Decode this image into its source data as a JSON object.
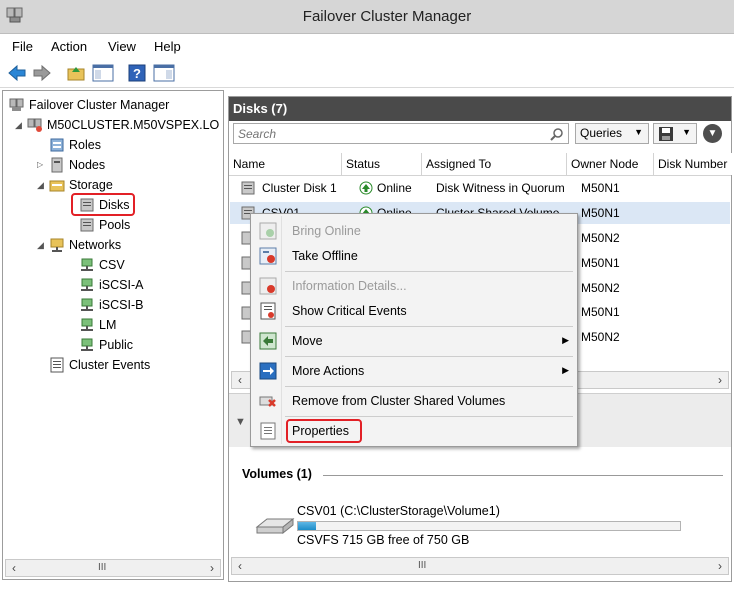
{
  "window": {
    "title": "Failover Cluster Manager"
  },
  "menu": [
    "File",
    "Action",
    "View",
    "Help"
  ],
  "tree": {
    "root": "Failover Cluster Manager",
    "cluster": "M50CLUSTER.M50VSPEX.LO",
    "roles": "Roles",
    "nodes": "Nodes",
    "storage": "Storage",
    "disks": "Disks",
    "pools": "Pools",
    "networks": "Networks",
    "net_csv": "CSV",
    "net_iscsi_a": "iSCSI-A",
    "net_iscsi_b": "iSCSI-B",
    "net_lm": "LM",
    "net_public": "Public",
    "cluster_events": "Cluster Events"
  },
  "scroll": {
    "thumb": "III"
  },
  "disks": {
    "header": "Disks (7)",
    "search_placeholder": "Search",
    "queries_label": "Queries",
    "columns": [
      "Name",
      "Status",
      "Assigned To",
      "Owner Node",
      "Disk Number"
    ],
    "rows": [
      {
        "name": "Cluster Disk 1",
        "status": "Online",
        "assigned": "Disk Witness in Quorum",
        "owner": "M50N1"
      },
      {
        "name": "CSV01",
        "status": "Online",
        "assigned": "Cluster Shared Volume",
        "owner": "M50N1"
      },
      {
        "owner": "M50N2"
      },
      {
        "owner": "M50N1"
      },
      {
        "owner": "M50N2"
      },
      {
        "owner": "M50N1"
      },
      {
        "owner": "M50N2"
      }
    ]
  },
  "volumes": {
    "label": "Volumes (1)",
    "name": "CSV01 (C:\\ClusterStorage\\Volume1)",
    "free_text": "CSVFS 715 GB free of 750 GB",
    "used_fraction": 0.047
  },
  "context_menu": {
    "bring_online": "Bring Online",
    "take_offline": "Take Offline",
    "information_details": "Information Details...",
    "show_critical_events": "Show Critical Events",
    "move": "Move",
    "more_actions": "More Actions",
    "remove_csv": "Remove from Cluster Shared Volumes",
    "properties": "Properties"
  },
  "colors": {
    "highlight_box": "#e22026",
    "selection": "#dbe7f5",
    "header_bar": "#4a4a4a"
  }
}
